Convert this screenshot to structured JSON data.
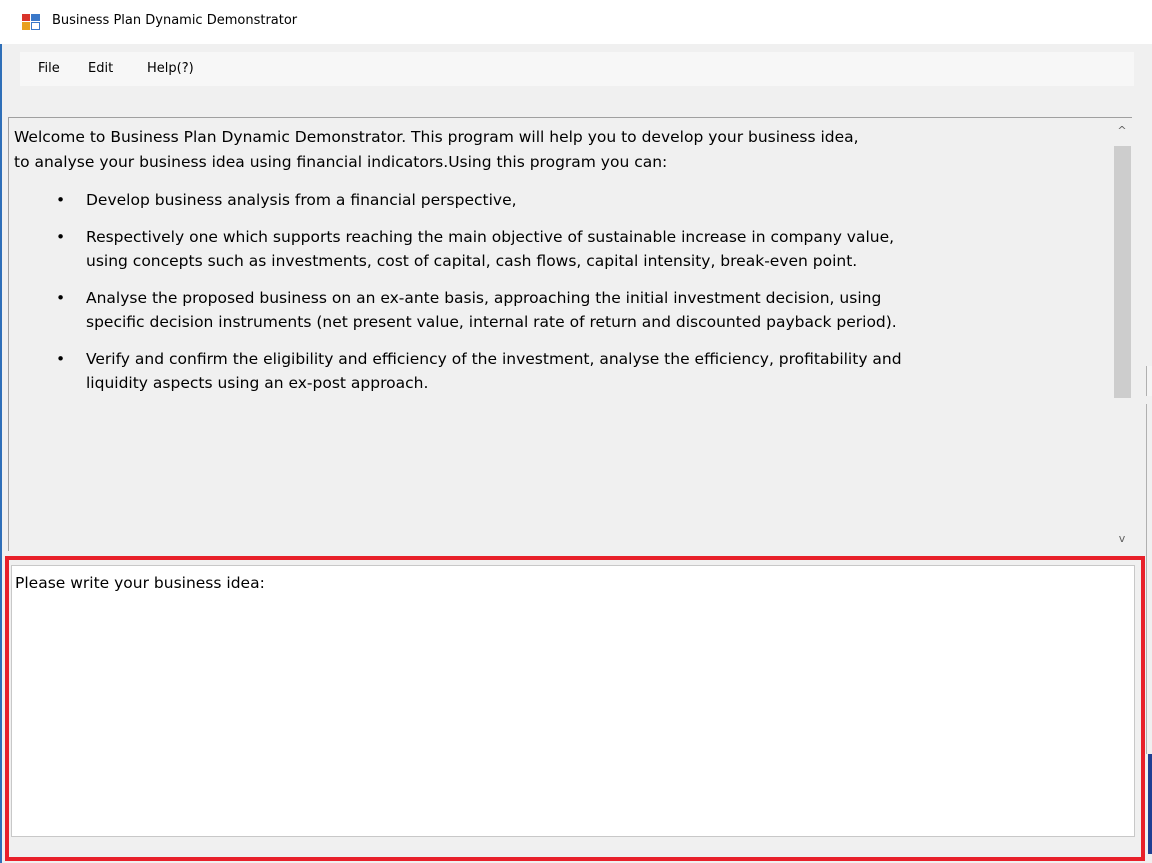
{
  "window": {
    "title": "Business Plan Dynamic Demonstrator",
    "icon": "application-window-icon"
  },
  "menu": {
    "items": [
      {
        "label": "File"
      },
      {
        "label": "Edit"
      },
      {
        "label": "Help(?)"
      }
    ]
  },
  "info": {
    "welcome": "Welcome to Business Plan Dynamic Demonstrator. This program will help you to develop your business idea, to analyse your business idea using financial indicators.Using this program you can:",
    "bullets": [
      "Develop business analysis from a financial perspective,",
      "Respectively one which supports reaching the main objective of sustainable increase in company value, using concepts such as investments, cost of capital, cash flows, capital intensity, break-even point.",
      "Analyse the proposed business on an ex-ante basis, approaching the initial investment decision, using specific decision instruments (net present value, internal rate of return and discounted payback period).",
      "Verify and confirm the eligibility and efficiency of the investment, analyse the efficiency, profitability and liquidity aspects using an ex-post approach."
    ],
    "scroll_up_glyph": "^",
    "scroll_down_glyph": "v"
  },
  "input": {
    "prompt": "Please write your business idea:",
    "value": ""
  },
  "colors": {
    "highlight_border": "#e8202a",
    "window_bg": "#f0f0f0",
    "scroll_thumb": "#cdcdcd"
  }
}
